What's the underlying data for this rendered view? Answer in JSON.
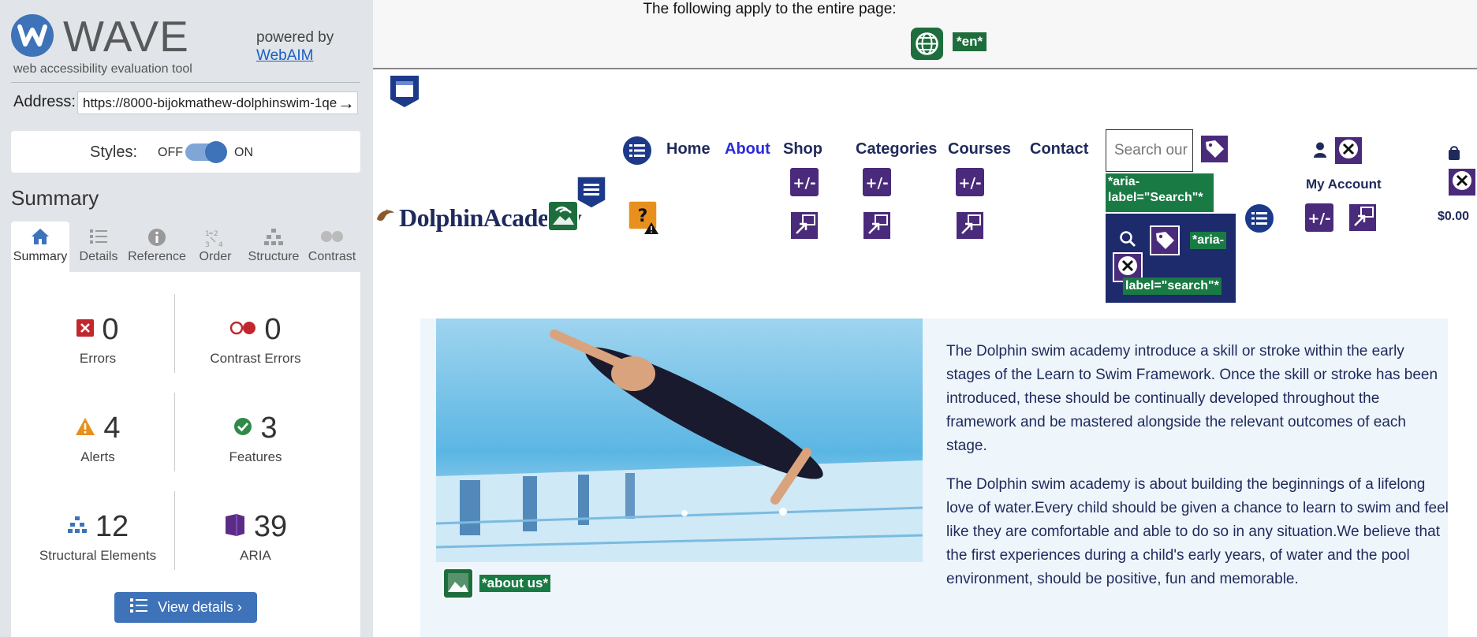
{
  "wave": {
    "logo_text": "WAVE",
    "tagline": "web accessibility evaluation tool",
    "powered_by": "powered by",
    "webaim_link": "WebAIM",
    "address_label": "Address:",
    "address_value": "https://8000-bijokmathew-dolphinswim-1qe",
    "go_icon": "arrow-right-icon",
    "styles_label": "Styles:",
    "styles_off": "OFF",
    "styles_on": "ON",
    "summary_title": "Summary",
    "tabs": [
      {
        "label": "Summary",
        "icon": "home-icon"
      },
      {
        "label": "Details",
        "icon": "list-icon"
      },
      {
        "label": "Reference",
        "icon": "info-icon"
      },
      {
        "label": "Order",
        "icon": "order-icon"
      },
      {
        "label": "Structure",
        "icon": "structure-icon"
      },
      {
        "label": "Contrast",
        "icon": "contrast-icon"
      }
    ],
    "stats": {
      "errors": {
        "value": "0",
        "label": "Errors"
      },
      "contrast_errors": {
        "value": "0",
        "label": "Contrast Errors"
      },
      "alerts": {
        "value": "4",
        "label": "Alerts"
      },
      "features": {
        "value": "3",
        "label": "Features"
      },
      "structural": {
        "value": "12",
        "label": "Structural Elements"
      },
      "aria": {
        "value": "39",
        "label": "ARIA"
      }
    },
    "view_details": "View details ›",
    "colors": {
      "accent": "#3e72b9",
      "error": "#c0282d",
      "alert": "#e8901e",
      "feature": "#2f8a4a",
      "aria": "#5b2c86"
    }
  },
  "page": {
    "header_text": "The following apply to the entire page:",
    "lang_tag": "*en*",
    "nav": [
      "Home",
      "About",
      "Shop",
      "Categories",
      "Courses",
      "Contact"
    ],
    "search_placeholder": "Search our shop",
    "aria_search_1": "*aria-label=\"Search\"*",
    "aria_search_2a": "*aria-",
    "aria_search_2b": "label=\"search\"*",
    "my_account": "My Account",
    "cart_total": "$0.00",
    "brand": "DolphinAcademy",
    "img_alt_tag": "*about us*",
    "paragraph_1": "The Dolphin swim academy introduce a skill or stroke within the early stages of the Learn to Swim Framework. Once the skill or stroke has been introduced, these should be continually developed throughout the framework and be mastered alongside the relevant outcomes of each stage.",
    "paragraph_2": "The Dolphin swim academy is about building the beginnings of a lifelong love of water.Every child should be given a chance to learn to swim and feel like they are comfortable and able to do so in any situation.We believe that the first experiences during a child's early years, of water and the pool environment, should be positive, fun and memorable."
  }
}
